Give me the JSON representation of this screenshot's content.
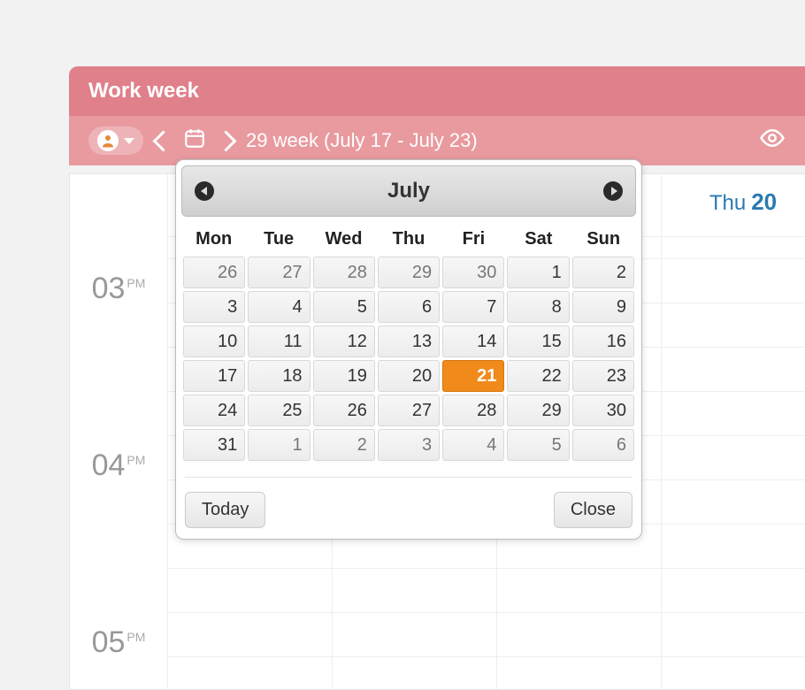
{
  "header": {
    "title": "Work week"
  },
  "toolbar": {
    "period": "29 week  (July 17 - July 23)"
  },
  "day_header": {
    "dow": "Thu",
    "num": "20"
  },
  "hours": [
    {
      "h": "03",
      "ampm": "PM"
    },
    {
      "h": "04",
      "ampm": "PM"
    },
    {
      "h": "05",
      "ampm": "PM"
    }
  ],
  "picker": {
    "month": "July",
    "today_btn": "Today",
    "close_btn": "Close",
    "dow": [
      "Mon",
      "Tue",
      "Wed",
      "Thu",
      "Fri",
      "Sat",
      "Sun"
    ],
    "weeks": [
      [
        {
          "n": "26",
          "o": true
        },
        {
          "n": "27",
          "o": true
        },
        {
          "n": "28",
          "o": true
        },
        {
          "n": "29",
          "o": true
        },
        {
          "n": "30",
          "o": true
        },
        {
          "n": "1"
        },
        {
          "n": "2"
        }
      ],
      [
        {
          "n": "3"
        },
        {
          "n": "4"
        },
        {
          "n": "5"
        },
        {
          "n": "6"
        },
        {
          "n": "7"
        },
        {
          "n": "8"
        },
        {
          "n": "9"
        }
      ],
      [
        {
          "n": "10"
        },
        {
          "n": "11"
        },
        {
          "n": "12"
        },
        {
          "n": "13"
        },
        {
          "n": "14"
        },
        {
          "n": "15"
        },
        {
          "n": "16"
        }
      ],
      [
        {
          "n": "17"
        },
        {
          "n": "18"
        },
        {
          "n": "19"
        },
        {
          "n": "20"
        },
        {
          "n": "21",
          "sel": true
        },
        {
          "n": "22"
        },
        {
          "n": "23"
        }
      ],
      [
        {
          "n": "24"
        },
        {
          "n": "25"
        },
        {
          "n": "26"
        },
        {
          "n": "27"
        },
        {
          "n": "28"
        },
        {
          "n": "29"
        },
        {
          "n": "30"
        }
      ],
      [
        {
          "n": "31"
        },
        {
          "n": "1",
          "o": true
        },
        {
          "n": "2",
          "o": true
        },
        {
          "n": "3",
          "o": true
        },
        {
          "n": "4",
          "o": true
        },
        {
          "n": "5",
          "o": true
        },
        {
          "n": "6",
          "o": true
        }
      ]
    ]
  }
}
